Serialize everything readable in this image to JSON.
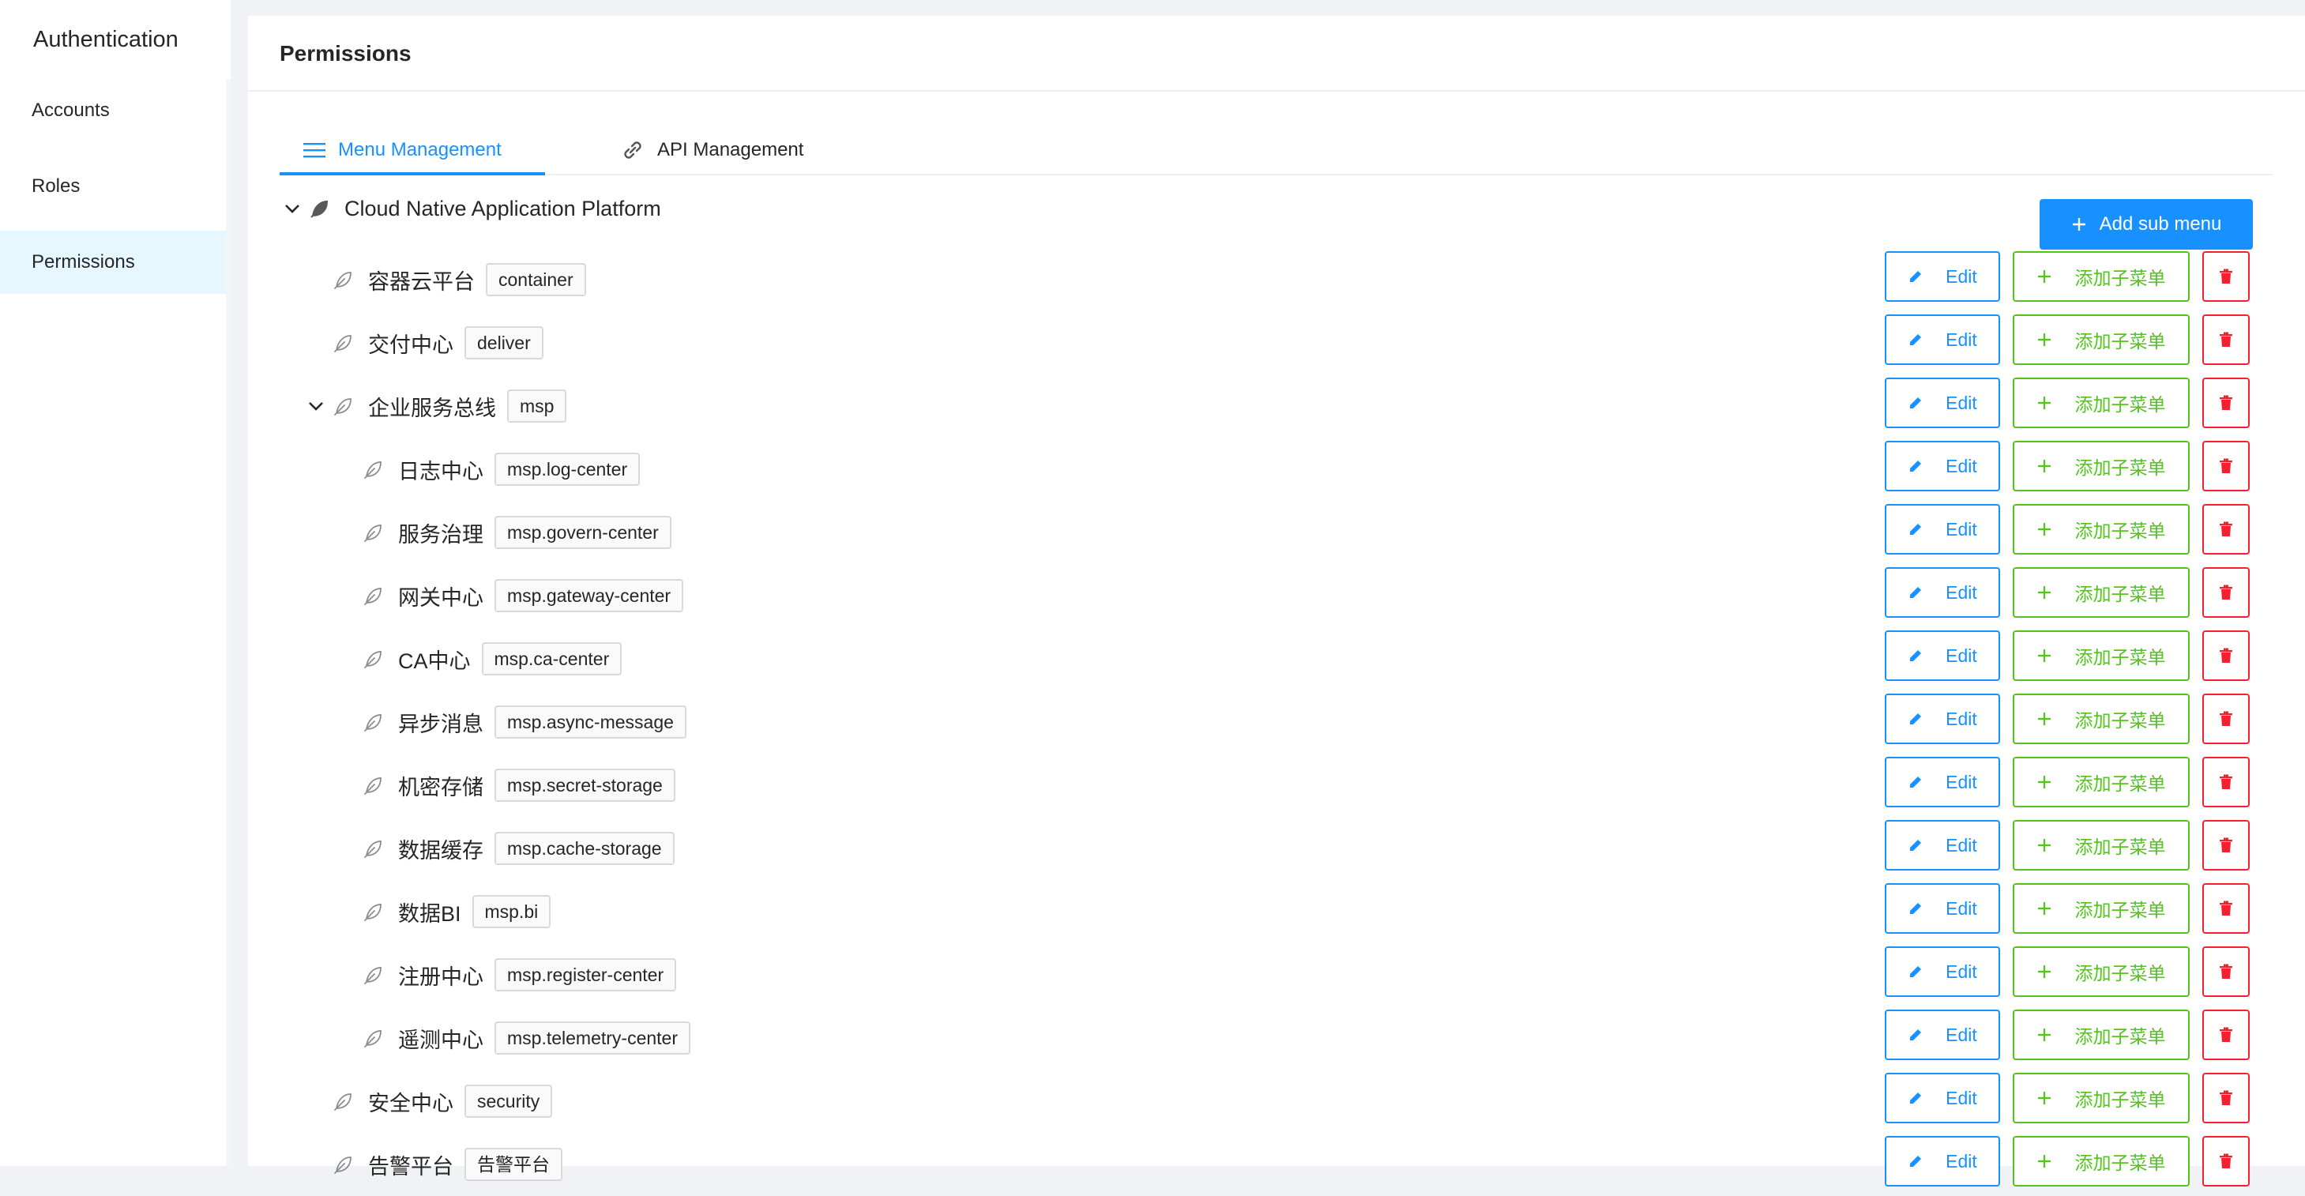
{
  "sidebar": {
    "brand": "Authentication",
    "items": [
      {
        "label": "Accounts"
      },
      {
        "label": "Roles"
      },
      {
        "label": "Permissions"
      }
    ]
  },
  "page": {
    "title": "Permissions",
    "tabs": [
      {
        "label": "Menu Management"
      },
      {
        "label": "API Management"
      }
    ],
    "add_sub_menu": "Add sub menu",
    "edit_label": "Edit",
    "add_child_label": "添加子菜单",
    "root_title": "Cloud Native Application Platform"
  },
  "tree": [
    {
      "title": "容器云平台",
      "key": "container"
    },
    {
      "title": "交付中心",
      "key": "deliver"
    },
    {
      "title": "企业服务总线",
      "key": "msp"
    },
    {
      "title": "日志中心",
      "key": "msp.log-center"
    },
    {
      "title": "服务治理",
      "key": "msp.govern-center"
    },
    {
      "title": "网关中心",
      "key": "msp.gateway-center"
    },
    {
      "title": "CA中心",
      "key": "msp.ca-center"
    },
    {
      "title": "异步消息",
      "key": "msp.async-message"
    },
    {
      "title": "机密存储",
      "key": "msp.secret-storage"
    },
    {
      "title": "数据缓存",
      "key": "msp.cache-storage"
    },
    {
      "title": "数据BI",
      "key": "msp.bi"
    },
    {
      "title": "注册中心",
      "key": "msp.register-center"
    },
    {
      "title": "遥测中心",
      "key": "msp.telemetry-center"
    },
    {
      "title": "安全中心",
      "key": "security"
    },
    {
      "title": "告警平台",
      "key": "告警平台"
    }
  ],
  "colors": {
    "primary": "#1890ff",
    "success": "#52c41a",
    "danger": "#f5222d",
    "active_bg": "#e6f7ff"
  },
  "icons": {
    "menu_tab": "menu-icon",
    "api_tab": "link-icon",
    "node": "leaf-icon",
    "edit": "edit-icon",
    "add": "plus-icon",
    "delete": "delete-icon",
    "expand": "chevron-down-icon"
  }
}
